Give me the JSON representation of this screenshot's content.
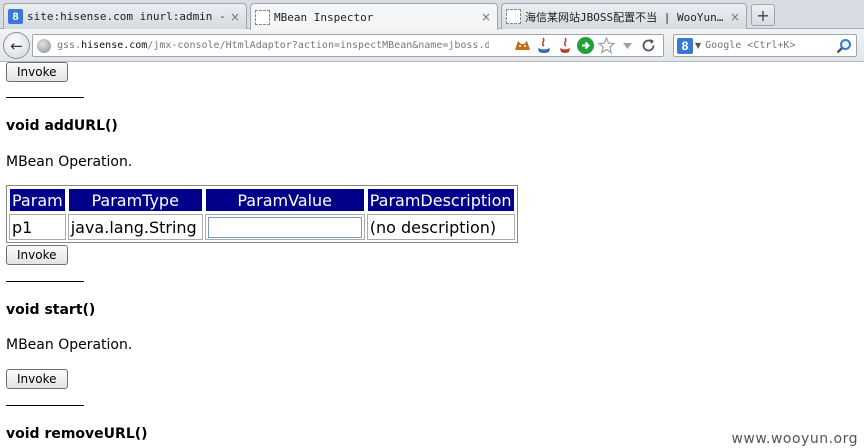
{
  "browser": {
    "tabs": [
      {
        "title": "site:hisense.com inurl:admin - G…",
        "favicon": "google-icon",
        "active": false
      },
      {
        "title": "MBean Inspector",
        "favicon": "page-icon",
        "active": true
      },
      {
        "title": "海信某网站JBOSS配置不当 | WooYun…",
        "favicon": "page-icon",
        "active": false
      }
    ],
    "close_glyph": "×",
    "new_tab_glyph": "+",
    "back_glyph": "←",
    "url_prefix": "gss.",
    "url_domain": "hisense.com",
    "url_rest": "/jmx-console/HtmlAdaptor?action=inspectMBean&name=jboss.deplo",
    "search_placeholder": "Google <Ctrl+K>",
    "search_engine_letter": "8"
  },
  "page": {
    "invoke_label": "Invoke",
    "operations": [
      {
        "signature": "void addURL()",
        "description": "MBean Operation."
      },
      {
        "signature": "void start()",
        "description": "MBean Operation."
      },
      {
        "signature": "void removeURL()"
      }
    ],
    "param_table": {
      "headers": [
        "Param",
        "ParamType",
        "ParamValue",
        "ParamDescription"
      ],
      "row": {
        "param": "p1",
        "type": "java.lang.String",
        "value": "",
        "description": "(no description)"
      }
    }
  },
  "watermark": "www.wooyun.org",
  "colors": {
    "table_header_bg": "#00008b",
    "table_header_text": "#ffffff"
  }
}
